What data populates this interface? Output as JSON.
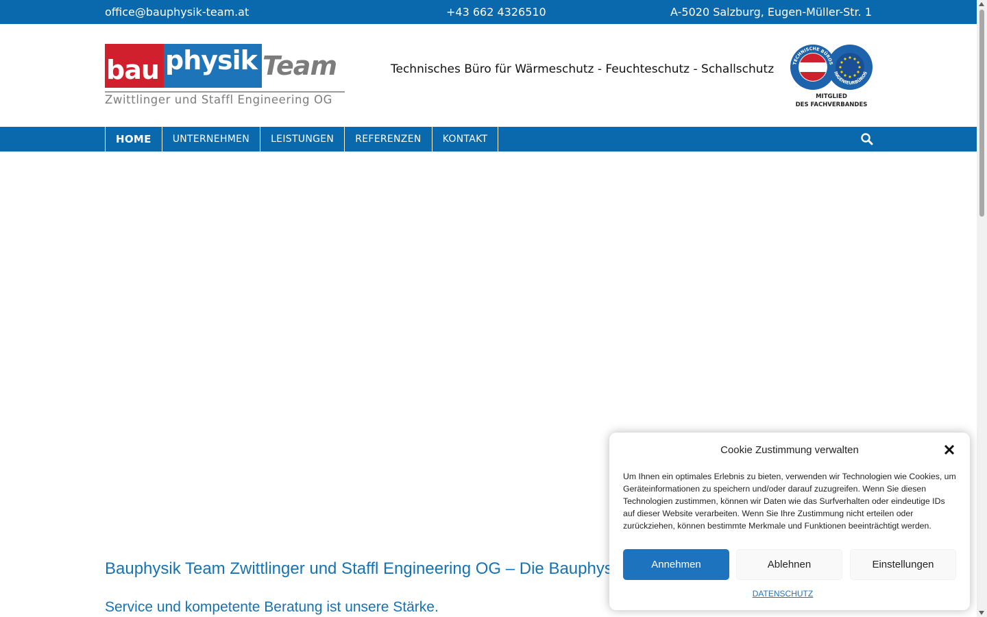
{
  "topbar": {
    "email": "office@bauphysik-team.at",
    "phone": "+43 662 4326510",
    "address": "A-5020 Salzburg, Eugen-Müller-Str. 1"
  },
  "logo": {
    "part1": "bau",
    "part2": "physik",
    "part3": "Team",
    "subtitle": "Zwittlinger und Staffl Engineering OG",
    "colors": {
      "red": "#d0202d",
      "blue": "#1d74b9",
      "gray": "#7c7c7c"
    }
  },
  "header": {
    "tagline": "Technisches Büro für Wärmeschutz - Feuchteschutz - Schallschutz"
  },
  "badge": {
    "ring_left": "TECHNISCHE BÜROS",
    "ring_right": "INGENIEURBÜROS",
    "line1": "MITGLIED",
    "line2": "DES FACHVERBANDES"
  },
  "nav": {
    "items": [
      {
        "label": "HOME",
        "active": true
      },
      {
        "label": "UNTERNEHMEN",
        "active": false
      },
      {
        "label": "LEISTUNGEN",
        "active": false
      },
      {
        "label": "REFERENZEN",
        "active": false
      },
      {
        "label": "KONTAKT",
        "active": false
      }
    ],
    "search_icon": "search-icon"
  },
  "content": {
    "headline": "Bauphysik Team Zwittlinger und Staffl Engineering OG – Die Bauphysiker",
    "subline": "Service und kompetente Beratung ist unsere Stärke."
  },
  "cookie": {
    "title": "Cookie Zustimmung verwalten",
    "body": "Um Ihnen ein optimales Erlebnis zu bieten, verwenden wir Technologien wie Cookies, um Geräteinformationen zu speichern und/oder darauf zuzugreifen. Wenn Sie diesen Technologien zustimmen, können wir Daten wie das Surfverhalten oder eindeutige IDs auf dieser Website verarbeiten. Wenn Sie Ihre Zustimmung nicht erteilen oder zurückziehen, können bestimmte Merkmale und Funktionen beeinträchtigt werden.",
    "accept": "Annehmen",
    "deny": "Ablehnen",
    "preferences": "Einstellungen",
    "privacy": "DATENSCHUTZ",
    "close_icon": "close-icon"
  },
  "theme": {
    "primary": "#0a68ad",
    "link": "#1572b3",
    "button": "#1e73be"
  }
}
